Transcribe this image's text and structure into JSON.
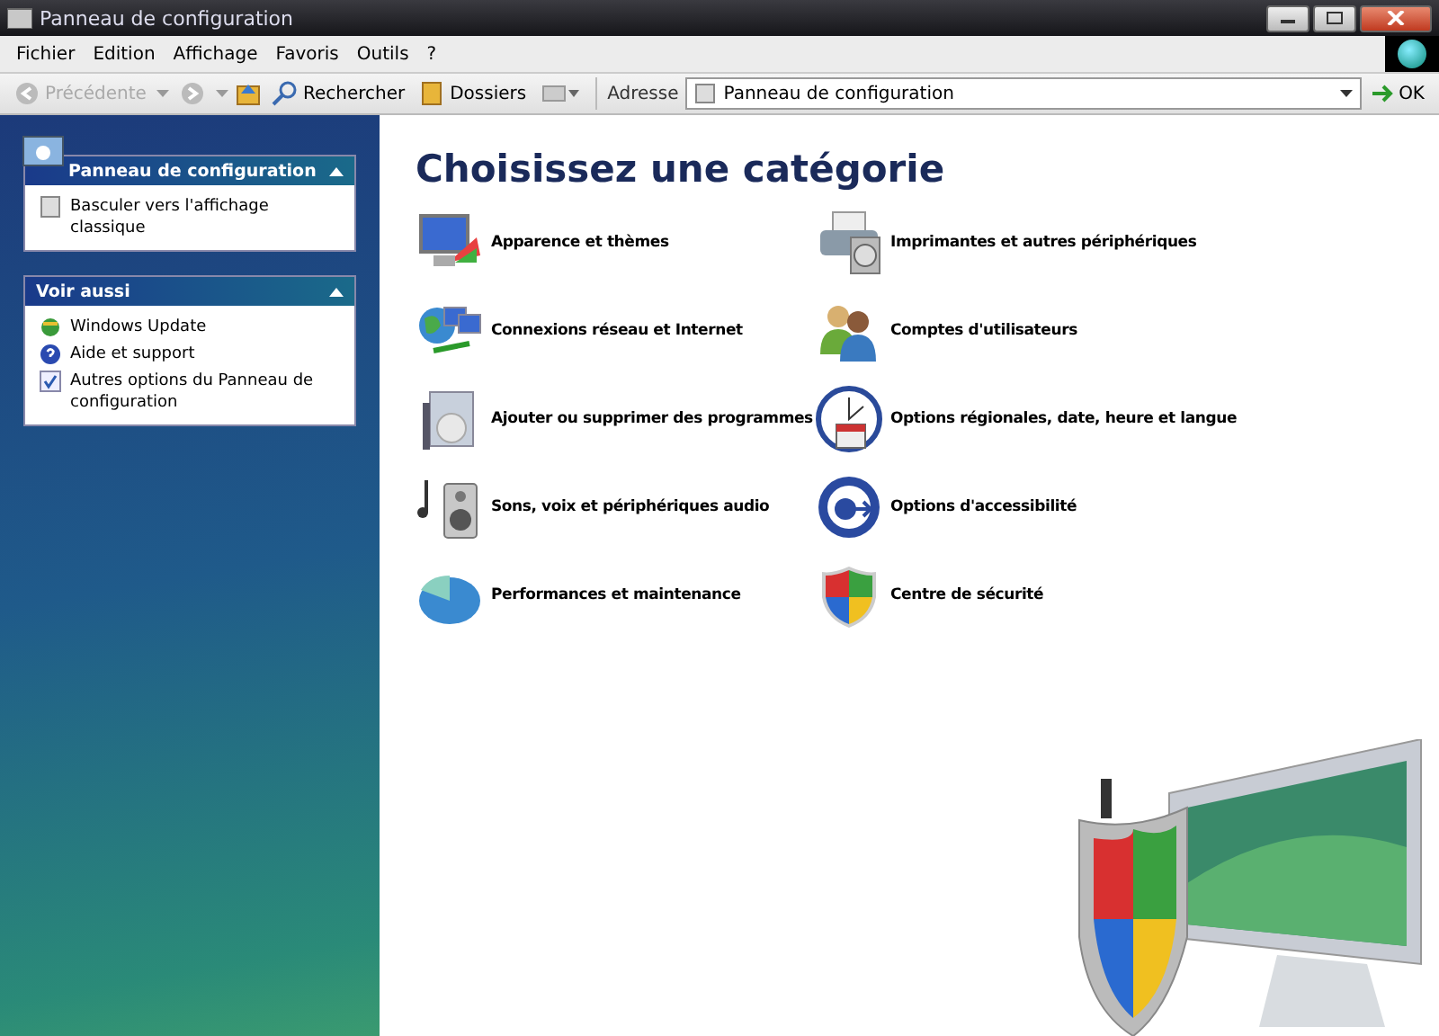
{
  "window": {
    "title": "Panneau de configuration"
  },
  "menu": [
    "Fichier",
    "Edition",
    "Affichage",
    "Favoris",
    "Outils",
    "?"
  ],
  "toolbar": {
    "back": {
      "label": "Précédente",
      "disabled": true
    },
    "forward": {
      "disabled": true
    },
    "search": "Rechercher",
    "folders": "Dossiers"
  },
  "address": {
    "label": "Adresse",
    "value": "Panneau de configuration",
    "go": "OK"
  },
  "sidebar": {
    "panels": [
      {
        "title": "Panneau de configuration",
        "expanded": true,
        "items": [
          "Basculer vers l'affichage classique"
        ]
      },
      {
        "title": "Voir aussi",
        "expanded": true,
        "items": [
          "Windows Update",
          "Aide et support",
          "Autres options du Panneau de configuration"
        ]
      }
    ]
  },
  "heading": "Choisissez une catégorie",
  "categories": [
    {
      "label": "Apparence et thèmes"
    },
    {
      "label": "Imprimantes et autres périphériques"
    },
    {
      "label": "Connexions réseau et Internet"
    },
    {
      "label": "Comptes d'utilisateurs"
    },
    {
      "label": "Ajouter ou supprimer des programmes"
    },
    {
      "label": "Options régionales, date, heure et langue"
    },
    {
      "label": "Sons, voix et périphériques audio"
    },
    {
      "label": "Options d'accessibilité"
    },
    {
      "label": "Performances et maintenance"
    },
    {
      "label": "Centre de sécurité"
    }
  ]
}
